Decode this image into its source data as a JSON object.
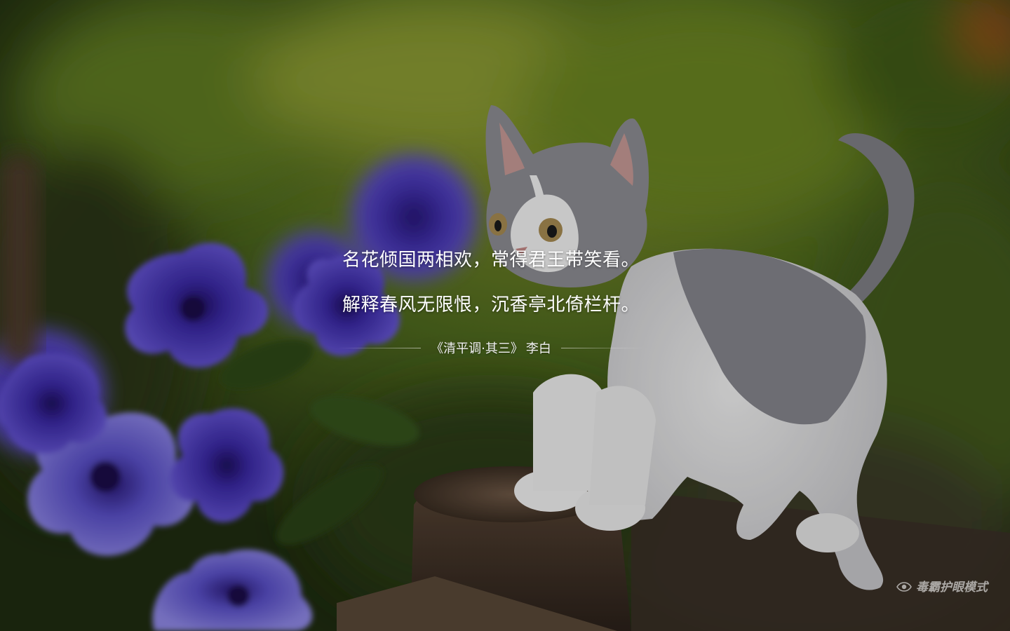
{
  "poem": {
    "lines": [
      "名花倾国两相欢，常得君王带笑看。",
      "解释春风无限恨，沉香亭北倚栏杆。"
    ],
    "title": "《清平调·其三》",
    "author": "李白"
  },
  "eye_mode": {
    "label": "毒霸护眼模式",
    "icon": "eye-icon"
  },
  "colors": {
    "text": "#ffffff",
    "background_foliage": "#4d6b1f",
    "flower": "#4b34b8",
    "kitten_grey": "#8a8a90"
  }
}
